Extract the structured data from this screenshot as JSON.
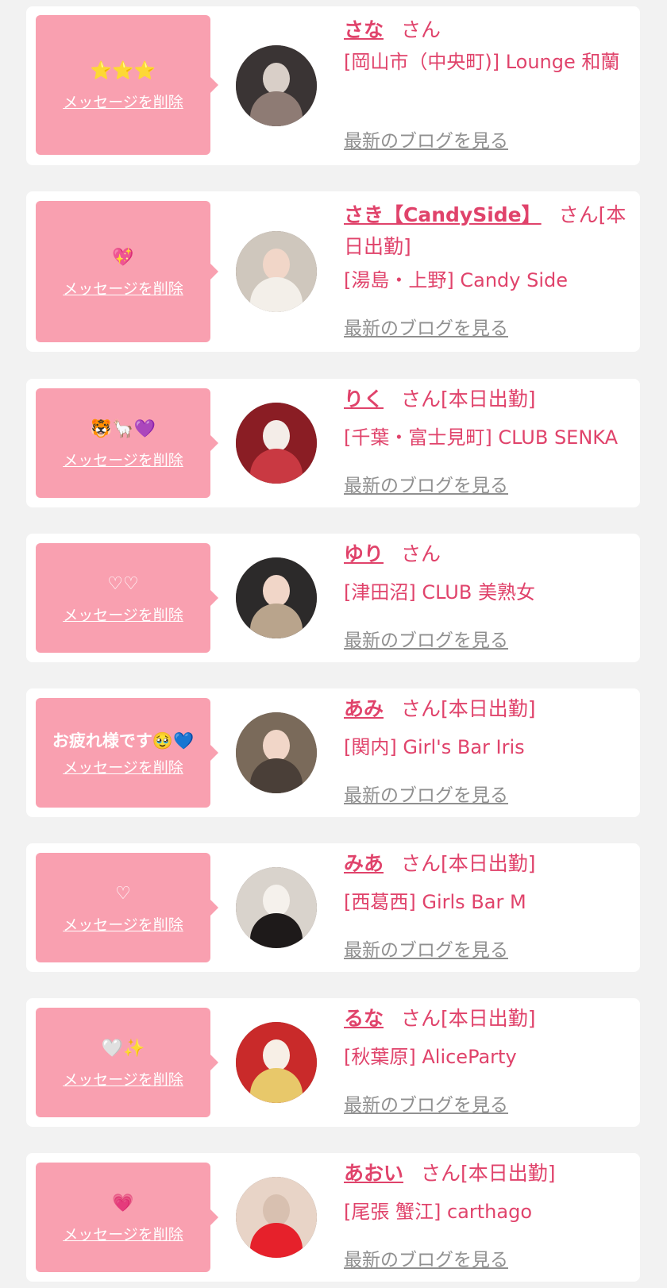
{
  "cards": [
    {
      "message": "⭐⭐⭐",
      "delete_label": "メッセージを削除",
      "name": "さな",
      "suffix": "さん",
      "shop": "[岡山市（中央町)] Lounge 和蘭",
      "blog_link": "最新のブログを見る",
      "avatar_colors": [
        "#3a3434",
        "#8e7b74",
        "#d9cfc8"
      ]
    },
    {
      "message": "💖",
      "delete_label": "メッセージを削除",
      "name": "さき【CandySide】",
      "suffix": "さん[本日出勤]",
      "shop": "[湯島・上野] Candy Side",
      "blog_link": "最新のブログを見る",
      "avatar_colors": [
        "#cfc7bd",
        "#f3efe9",
        "#1f1b1b"
      ]
    },
    {
      "message": "🐯🦙💜",
      "delete_label": "メッセージを削除",
      "name": "りく",
      "suffix": "さん[本日出勤]",
      "shop": "[千葉・富士見町] CLUB SENKA",
      "blog_link": "最新のブログを見る",
      "avatar_colors": [
        "#8a1d24",
        "#c93942",
        "#f4ede8"
      ]
    },
    {
      "message": "♡♡",
      "delete_label": "メッセージを削除",
      "name": "ゆり",
      "suffix": "さん",
      "shop": "[津田沼] CLUB 美熟女",
      "blog_link": "最新のブログを見る",
      "avatar_colors": [
        "#2c2a2a",
        "#b9a48c",
        "#3a2e2a"
      ]
    },
    {
      "message": "お疲れ様です🥹💙",
      "delete_label": "メッセージを削除",
      "name": "あみ",
      "suffix": "さん[本日出勤]",
      "shop": "[関内] Girl's Bar Iris",
      "blog_link": "最新のブログを見る",
      "avatar_colors": [
        "#7a6a5a",
        "#cdb8a2",
        "#4a3f38"
      ]
    },
    {
      "message": "♡",
      "delete_label": "メッセージを削除",
      "name": "みあ",
      "suffix": "さん[本日出勤]",
      "shop": "[西葛西] Girls Bar M",
      "blog_link": "最新のブログを見る",
      "avatar_colors": [
        "#d9d3cc",
        "#1e1a1a",
        "#f5f1ec"
      ]
    },
    {
      "message": "🤍✨",
      "delete_label": "メッセージを削除",
      "name": "るな",
      "suffix": "さん[本日出勤]",
      "shop": "[秋葉原] AliceParty",
      "blog_link": "最新のブログを見る",
      "avatar_colors": [
        "#c92a2a",
        "#f7efe6",
        "#e8c86a"
      ]
    },
    {
      "message": "💗",
      "delete_label": "メッセージを削除",
      "name": "あおい",
      "suffix": "さん[本日出勤]",
      "shop": "[尾張 蟹江] carthago",
      "blog_link": "最新のブログを見る",
      "avatar_colors": [
        "#e8d4c7",
        "#d8c0b0",
        "#e6212b"
      ]
    }
  ]
}
